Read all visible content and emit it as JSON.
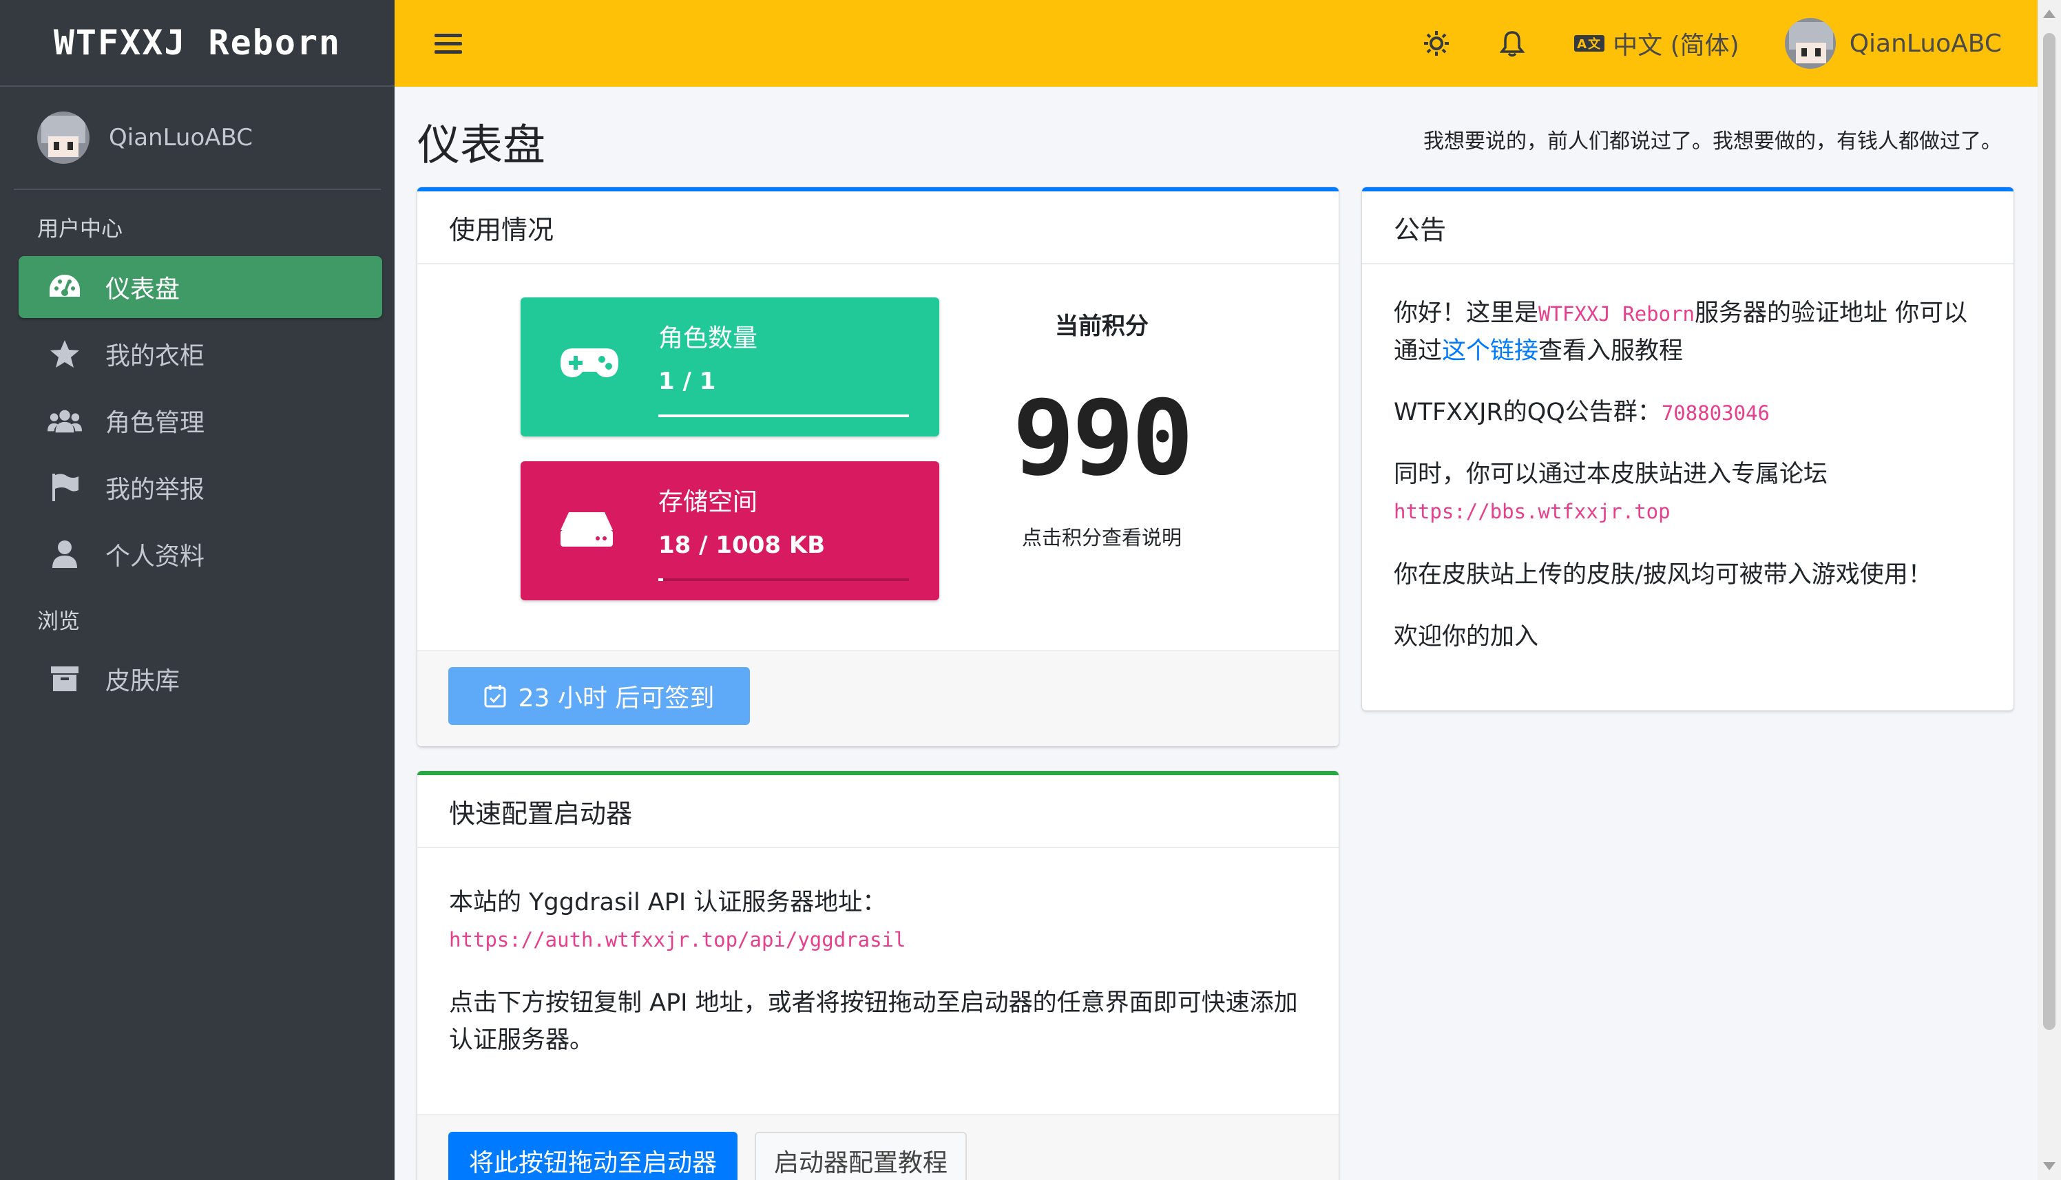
{
  "sidebar": {
    "brand": "WTFXXJ Reborn",
    "username": "QianLuoABC",
    "section_user": "用户中心",
    "section_browse": "浏览",
    "items": [
      {
        "label": "仪表盘",
        "icon": "dashboard-icon"
      },
      {
        "label": "我的衣柜",
        "icon": "star-icon"
      },
      {
        "label": "角色管理",
        "icon": "users-icon"
      },
      {
        "label": "我的举报",
        "icon": "flag-icon"
      },
      {
        "label": "个人资料",
        "icon": "user-icon"
      }
    ],
    "browse_items": [
      {
        "label": "皮肤库",
        "icon": "archive-icon"
      }
    ]
  },
  "topbar": {
    "language": "中文 (简体)",
    "username": "QianLuoABC"
  },
  "page": {
    "title": "仪表盘",
    "motto": "我想要说的，前人们都说过了。我想要做的，有钱人都做过了。"
  },
  "usage": {
    "header": "使用情况",
    "players_label": "角色数量",
    "players_value": "1 / 1",
    "players_fraction": 1.0,
    "storage_label": "存储空间",
    "storage_value": "18 / 1008 KB",
    "storage_fraction": 0.018,
    "score_title": "当前积分",
    "score": "990",
    "score_hint": "点击积分查看说明",
    "checkin_label": "23 小时 后可签到",
    "colors": {
      "players": "#20c997",
      "storage": "#d81b60"
    }
  },
  "launcher": {
    "header": "快速配置启动器",
    "line1": "本站的 Yggdrasil API 认证服务器地址：",
    "api_url": "https://auth.wtfxxjr.top/api/yggdrasil",
    "line2": "点击下方按钮复制 API 地址，或者将按钮拖动至启动器的任意界面即可快速添加认证服务器。",
    "drag_button": "将此按钮拖动至启动器",
    "tutorial_button": "启动器配置教程"
  },
  "announcement": {
    "header": "公告",
    "p1_a": "你好！这里是",
    "p1_code": "WTFXXJ Reborn",
    "p1_b": "服务器的验证地址 你可以通过",
    "p1_link": "这个链接",
    "p1_c": "查看入服教程",
    "p2_a": "WTFXXJR的QQ公告群：",
    "p2_code": "708803046",
    "p3": "同时，你可以通过本皮肤站进入专属论坛",
    "p3_code": "https://bbs.wtfxxjr.top",
    "p4": "你在皮肤站上传的皮肤/披风均可被带入游戏使用！",
    "p5": "欢迎你的加入"
  }
}
